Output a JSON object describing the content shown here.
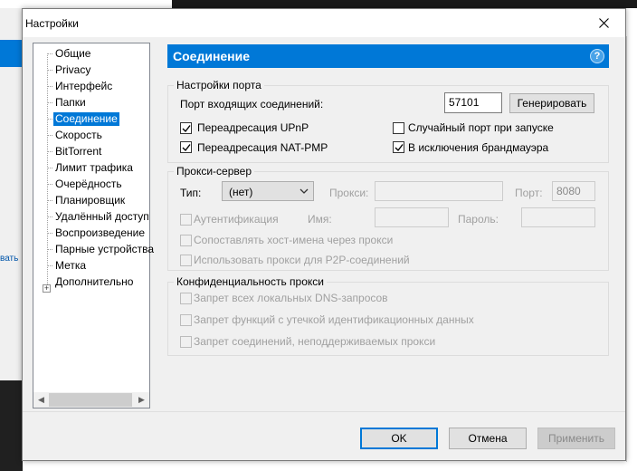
{
  "window": {
    "title": "Настройки"
  },
  "background": {
    "left_link": "вать"
  },
  "sidebar": {
    "items": [
      {
        "label": "Общие",
        "selected": false
      },
      {
        "label": "Privacy",
        "selected": false
      },
      {
        "label": "Интерфейс",
        "selected": false
      },
      {
        "label": "Папки",
        "selected": false
      },
      {
        "label": "Соединение",
        "selected": true
      },
      {
        "label": "Скорость",
        "selected": false
      },
      {
        "label": "BitTorrent",
        "selected": false
      },
      {
        "label": "Лимит трафика",
        "selected": false
      },
      {
        "label": "Очерёдность",
        "selected": false
      },
      {
        "label": "Планировщик",
        "selected": false
      },
      {
        "label": "Удалённый доступ",
        "selected": false
      },
      {
        "label": "Воспроизведение",
        "selected": false
      },
      {
        "label": "Парные устройства",
        "selected": false
      },
      {
        "label": "Метка",
        "selected": false
      },
      {
        "label": "Дополнительно",
        "selected": false
      }
    ],
    "expander": "+"
  },
  "panel": {
    "title": "Соединение",
    "help_icon": "?",
    "port_settings": {
      "title": "Настройки порта",
      "port_label": "Порт входящих соединений:",
      "port_value": "57101",
      "generate_button": "Генерировать",
      "upnp_label": "Переадресация UPnP",
      "upnp_checked": true,
      "random_port_label": "Случайный порт при запуске",
      "random_port_checked": false,
      "natpmp_label": "Переадресация NAT-PMP",
      "natpmp_checked": true,
      "firewall_label": "В исключения брандмауэра",
      "firewall_checked": true
    },
    "proxy": {
      "title": "Прокси-сервер",
      "type_label": "Тип:",
      "type_value": "(нет)",
      "proxy_label": "Прокси:",
      "proxy_value": "",
      "port_label": "Порт:",
      "port_value": "8080",
      "auth_label": "Аутентификация",
      "name_label": "Имя:",
      "password_label": "Пароль:",
      "resolve_label": "Сопоставлять хост-имена через прокси",
      "p2p_label": "Использовать прокси для P2P-соединений"
    },
    "privacy": {
      "title": "Конфиденциальность прокси",
      "dns_label": "Запрет всех локальных DNS-запросов",
      "leak_label": "Запрет функций с утечкой идентификационных данных",
      "unsupported_label": "Запрет соединений, неподдерживаемых прокси"
    }
  },
  "footer": {
    "ok": "OK",
    "cancel": "Отмена",
    "apply": "Применить"
  },
  "colors": {
    "accent": "#0078d7",
    "dialog_bg": "#f0f0f0"
  }
}
